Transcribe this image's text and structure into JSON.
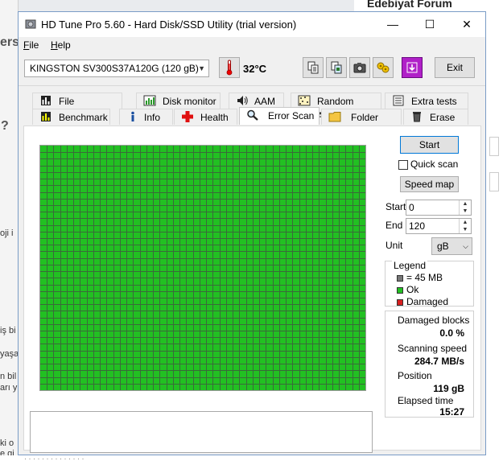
{
  "background": {
    "header_right": "Edebiyat Forum",
    "left_fragments": [
      "ers",
      "?",
      "oji i",
      "iş bi",
      "yaşa",
      "n bil",
      "arı y",
      "ki o",
      "e gi"
    ],
    "bottom_fragment": "· · · · · · · · · · · · · ·"
  },
  "window": {
    "title": "HD Tune Pro 5.60 - Hard Disk/SSD Utility (trial version)",
    "minimize": "—",
    "maximize": "☐",
    "close": "✕"
  },
  "menu": {
    "file": {
      "ul": "F",
      "rest": "ile"
    },
    "help": {
      "ul": "H",
      "rest": "elp"
    }
  },
  "toolbar": {
    "drive": "KINGSTON SV300S37A120G (120 gB)",
    "temperature": "32°C",
    "exit": "Exit"
  },
  "tabs": {
    "row1": [
      "File Benchmark",
      "Disk monitor",
      "AAM",
      "Random Access",
      "Extra tests"
    ],
    "row2": [
      "Benchmark",
      "Info",
      "Health",
      "Error Scan",
      "Folder Usage",
      "Erase"
    ],
    "active": "Error Scan"
  },
  "grid": {
    "cols": 49,
    "rows": 37,
    "block_status": "ok",
    "color_ok": "#22c022",
    "color_damaged": "#d81e1e",
    "color_unscanned": "#777777",
    "gridline": "#3a6a3a"
  },
  "controls": {
    "start": "Start",
    "quick_scan": "Quick scan",
    "speed_map": "Speed map",
    "start_label": "Start",
    "start_value": "0",
    "end_label": "End",
    "end_value": "120",
    "unit_label": "Unit",
    "unit_value": "gB"
  },
  "legend": {
    "title": "Legend",
    "block_size": "= 45 MB",
    "ok": "Ok",
    "damaged": "Damaged"
  },
  "stats": {
    "damaged_label": "Damaged blocks",
    "damaged_value": "0.0 %",
    "speed_label": "Scanning speed",
    "speed_value": "284.7 MB/s",
    "position_label": "Position",
    "position_value": "119 gB",
    "elapsed_label": "Elapsed time",
    "elapsed_value": "15:27"
  }
}
